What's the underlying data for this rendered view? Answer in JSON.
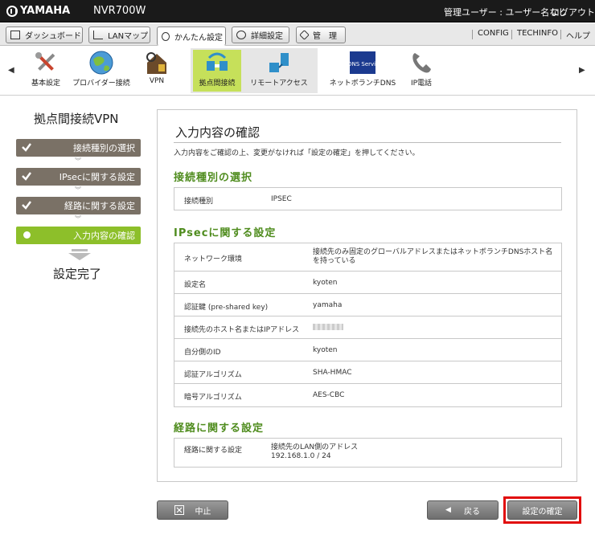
{
  "header": {
    "logo": "YAMAHA",
    "model": "NVR700W",
    "user": "管理ユーザー : ユーザー名なし",
    "logout": "ログアウト"
  },
  "nav": {
    "dashboard": "ダッシュボード",
    "lanmap": "LANマップ",
    "easy": "かんたん設定",
    "detail": "詳細設定",
    "admin": "管　理",
    "config": "CONFIG",
    "techinfo": "TECHINFO",
    "help": "ヘルプ"
  },
  "toolbar": {
    "basic": "基本設定",
    "provider": "プロバイダー接続",
    "vpn": "VPN",
    "site": "拠点間接続",
    "remote": "リモートアクセス",
    "ddns_badge": "DDNS Service",
    "ddns": "ネットボランチDNS",
    "ipphone": "IP電話"
  },
  "sidebar": {
    "title": "拠点間接続VPN",
    "steps": [
      "接続種別の選択",
      "IPsecに関する設定",
      "経路に関する設定",
      "入力内容の確認"
    ],
    "done": "設定完了"
  },
  "main": {
    "title": "入力内容の確認",
    "desc": "入力内容をご確認の上、変更がなければ「設定の確定」を押してください。",
    "sec1": "接続種別の選択",
    "conn_type_key": "接続種別",
    "conn_type_val": "IPSEC",
    "sec2": "IPsecに関する設定",
    "ipsec": [
      {
        "k": "ネットワーク環境",
        "v": "接続先のみ固定のグローバルアドレスまたはネットボランチDNSホスト名を持っている"
      },
      {
        "k": "設定名",
        "v": "kyoten"
      },
      {
        "k": "認証鍵 (pre-shared key)",
        "v": "yamaha"
      },
      {
        "k": "接続先のホスト名またはIPアドレス",
        "v": ""
      },
      {
        "k": "自分側のID",
        "v": "kyoten"
      },
      {
        "k": "認証アルゴリズム",
        "v": "SHA-HMAC"
      },
      {
        "k": "暗号アルゴリズム",
        "v": "AES-CBC"
      }
    ],
    "sec3": "経路に関する設定",
    "route_key": "経路に関する設定",
    "route_line1": "接続先のLAN側のアドレス",
    "route_line2": "192.168.1.0 / 24"
  },
  "buttons": {
    "cancel": "中止",
    "back": "戻る",
    "confirm": "設定の確定"
  },
  "colors": {
    "accent_green": "#8dbf2a",
    "section_green": "#4f8c1e",
    "highlight_red": "#e10b0b"
  }
}
